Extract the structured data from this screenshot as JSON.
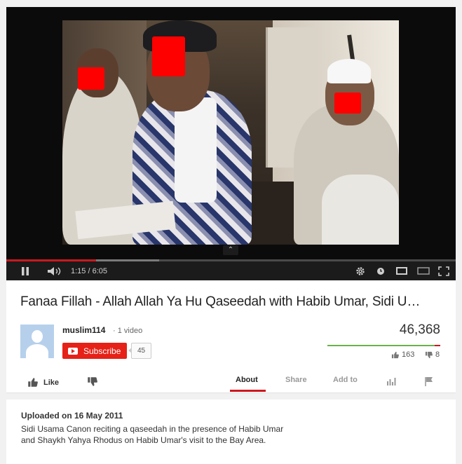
{
  "player": {
    "time_current": "1:15",
    "time_separator": " / ",
    "time_total": "6:05",
    "progress_played": 0.2,
    "progress_loaded": 0.34,
    "controls": {
      "play_pause_icon": "pause-icon",
      "volume_icon": "volume-icon",
      "settings_icon": "gear-icon",
      "watch_later_icon": "clock-icon",
      "small_player_icon": "small-player-icon",
      "theater_icon": "theater-mode-icon",
      "fullscreen_icon": "fullscreen-icon",
      "collapse_icon": "chevron-up-icon"
    }
  },
  "video": {
    "title": "Fanaa Fillah - Allah Allah Ya Hu Qaseedah with Habib Umar, Sidi U…"
  },
  "channel": {
    "name": "muslim114",
    "video_count": "· 1 video",
    "subscribe_label": "Subscribe",
    "subscriber_count": "45"
  },
  "stats": {
    "views": "46,368",
    "likes": "163",
    "dislikes": "8",
    "like_ratio": 0.953
  },
  "actions": {
    "like_label": "Like",
    "tabs": [
      "About",
      "Share",
      "Add to"
    ]
  },
  "description": {
    "upload_date": "Uploaded on 16 May 2011",
    "text": "Sidi Usama Canon reciting a qaseedah in the presence of Habib Umar and Shaykh Yahya Rhodus on Habib Umar's visit to the Bay Area."
  },
  "colors": {
    "accent_red": "#cc181e",
    "subscribe_red": "#e62117",
    "like_green": "#6ab04c"
  }
}
